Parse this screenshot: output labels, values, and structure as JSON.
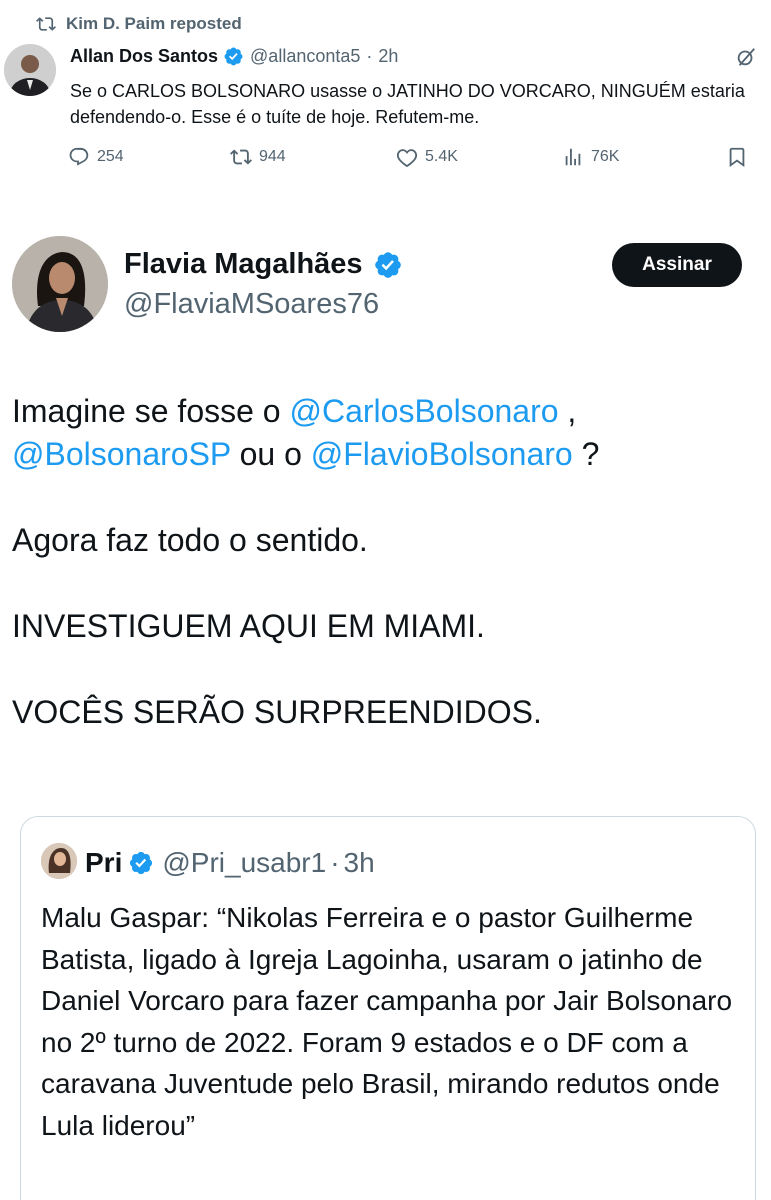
{
  "repost": {
    "reposted_by": "Kim D. Paim reposted",
    "author_name": "Allan Dos Santos",
    "author_handle": "@allanconta5",
    "separator": "·",
    "time": "2h",
    "text": "Se o CARLOS BOLSONARO usasse o JATINHO DO VORCARO, NINGUÉM estaria defendendo-o. Esse é o tuíte de hoje. Refutem-me.",
    "replies": "254",
    "reposts": "944",
    "likes": "5.4K",
    "views": "76K"
  },
  "main_tweet": {
    "author_name": "Flavia Magalhães",
    "author_handle": "@FlaviaMSoares76",
    "subscribe_label": "Assinar",
    "line1_a": "Imagine se fosse o ",
    "mention1": "@CarlosBolsonaro",
    "line1_b": " ,",
    "mention2": "@BolsonaroSP",
    "line2_a": " ou o ",
    "mention3": "@FlavioBolsonaro",
    "line2_b": " ?",
    "paragraph2": "Agora faz todo o sentido.",
    "paragraph3": "INVESTIGUEM AQUI EM MIAMI.",
    "paragraph4": "VOCÊS SERÃO SURPREENDIDOS."
  },
  "quoted_tweet": {
    "author_name": "Pri",
    "author_handle": "@Pri_usabr1",
    "separator": "·",
    "time": "3h",
    "text": "Malu Gaspar: “Nikolas Ferreira e o pastor Guilherme Batista, ligado à Igreja Lagoinha, usaram o jatinho de Daniel Vorcaro para fazer campanha por Jair Bolsonaro no 2º turno de 2022. Foram 9 estados e o DF com a caravana Juventude pelo Brasil, mirando redutos onde Lula liderou”"
  },
  "icons": {
    "repost": "repost-icon",
    "verified": "verified-badge-icon",
    "grok": "grok-icon",
    "reply": "reply-icon",
    "like": "heart-icon",
    "views": "views-icon",
    "bookmark": "bookmark-icon"
  },
  "colors": {
    "text": "#0f1419",
    "secondary": "#536471",
    "accent": "#1d9bf0",
    "button": "#0f1419",
    "border": "#cfd9de"
  }
}
